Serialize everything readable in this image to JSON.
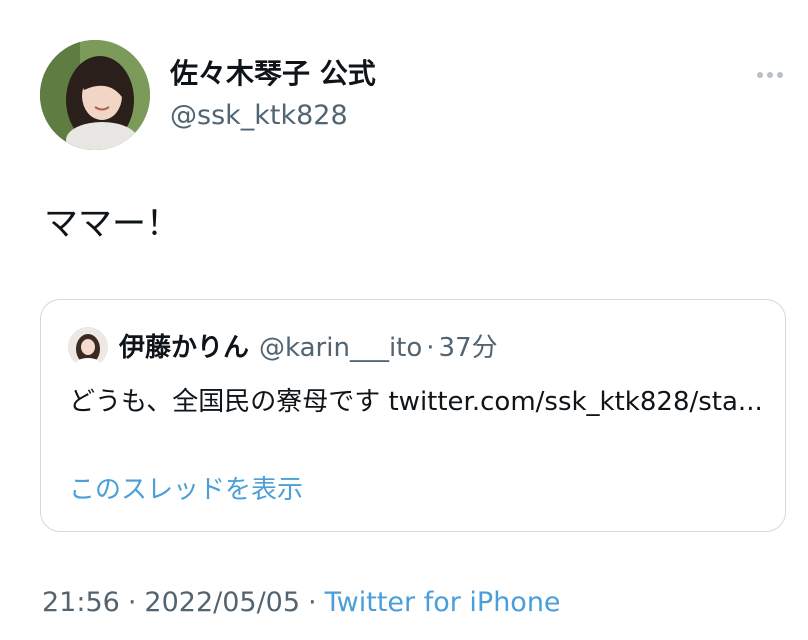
{
  "author": {
    "display_name": "佐々木琴子 公式",
    "username": "@ssk_ktk828"
  },
  "tweet": {
    "text": "ママー！"
  },
  "quote": {
    "display_name": "伊藤かりん",
    "username": "@karin___ito",
    "separator": "·",
    "time": "37分",
    "text": "どうも、全国民の寮母です twitter.com/ssk_ktk828/sta...",
    "show_thread_label": "このスレッドを表示"
  },
  "meta": {
    "time": "21:56",
    "separator": "·",
    "date": "2022/05/05",
    "source": "Twitter for iPhone"
  },
  "icons": {
    "more": "more-horizontal-icon"
  },
  "colors": {
    "link": "#4a9fd8",
    "secondary_text": "#536471",
    "border": "#cfd9de"
  }
}
